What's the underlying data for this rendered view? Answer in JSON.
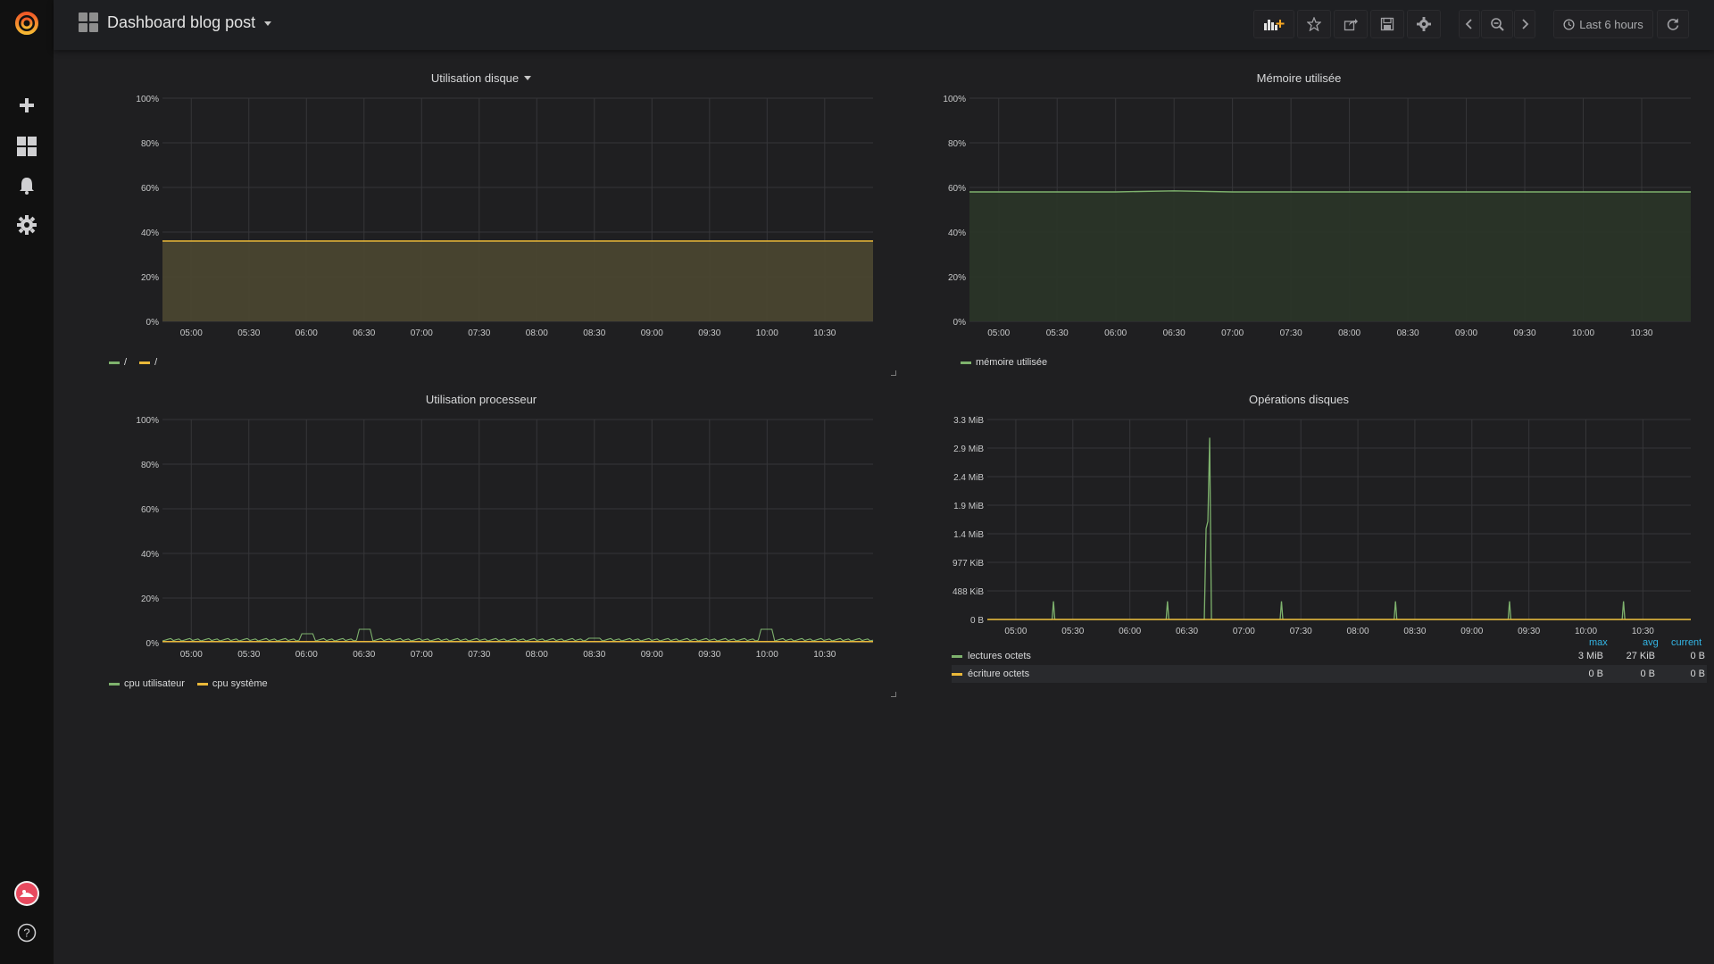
{
  "nav": {
    "title": "Dashboard blog post",
    "time_range": "Last 6 hours"
  },
  "sidemenu": {
    "icons": [
      "grafana-logo-icon",
      "plus-icon",
      "dashboards-icon",
      "bell-icon",
      "gear-icon",
      "avatar",
      "help-icon"
    ]
  },
  "colors": {
    "green": "#7eb26d",
    "yellow": "#eab839",
    "orange": "#ef843c",
    "blue_header": "#33b5e5",
    "panel_bg": "#1f1f21",
    "grid": "#363639"
  },
  "panels": {
    "disk": {
      "title": "Utilisation disque",
      "legend": [
        "/",
        "/"
      ]
    },
    "mem": {
      "title": "Mémoire utilisée",
      "legend": [
        "mémoire utilisée"
      ]
    },
    "cpu": {
      "title": "Utilisation processeur",
      "legend": [
        "cpu utilisateur",
        "cpu système"
      ]
    },
    "diskops": {
      "title": "Opérations disques",
      "legend_headers": [
        "max",
        "avg",
        "current"
      ],
      "legend_rows": [
        {
          "name": "lectures octets",
          "max": "3 MiB",
          "avg": "27 KiB",
          "current": "0 B"
        },
        {
          "name": "écriture octets",
          "max": "0 B",
          "avg": "0 B",
          "current": "0 B"
        }
      ]
    }
  },
  "chart_data": [
    {
      "type": "area",
      "title": "Utilisation disque",
      "x": [
        "05:00",
        "05:30",
        "06:00",
        "06:30",
        "07:00",
        "07:30",
        "08:00",
        "08:30",
        "09:00",
        "09:30",
        "10:00",
        "10:30"
      ],
      "y_ticks": [
        "0%",
        "20%",
        "40%",
        "60%",
        "80%",
        "100%"
      ],
      "ylim": [
        0,
        100
      ],
      "series": [
        {
          "name": "/",
          "color": "#7eb26d",
          "values": [
            36,
            36,
            36,
            36,
            36,
            36,
            36,
            36,
            36,
            36,
            36,
            36
          ]
        },
        {
          "name": "/",
          "color": "#eab839",
          "values": [
            36,
            36,
            36,
            36,
            36,
            36,
            36,
            36,
            36,
            36,
            36,
            36
          ]
        }
      ]
    },
    {
      "type": "area",
      "title": "Mémoire utilisée",
      "x": [
        "05:00",
        "05:30",
        "06:00",
        "06:30",
        "07:00",
        "07:30",
        "08:00",
        "08:30",
        "09:00",
        "09:30",
        "10:00",
        "10:30"
      ],
      "y_ticks": [
        "0%",
        "20%",
        "40%",
        "60%",
        "80%",
        "100%"
      ],
      "ylim": [
        0,
        100
      ],
      "series": [
        {
          "name": "mémoire utilisée",
          "color": "#7eb26d",
          "values": [
            58,
            58,
            58,
            58.5,
            58,
            58,
            58,
            58,
            58,
            58,
            58,
            58
          ]
        }
      ]
    },
    {
      "type": "line",
      "title": "Utilisation processeur",
      "x": [
        "05:00",
        "05:30",
        "06:00",
        "06:30",
        "07:00",
        "07:30",
        "08:00",
        "08:30",
        "09:00",
        "09:30",
        "10:00",
        "10:30"
      ],
      "y_ticks": [
        "0%",
        "20%",
        "40%",
        "60%",
        "80%",
        "100%"
      ],
      "ylim": [
        0,
        100
      ],
      "series": [
        {
          "name": "cpu utilisateur",
          "color": "#7eb26d",
          "values": [
            1,
            1,
            4,
            6,
            1,
            1,
            1,
            2,
            1,
            1,
            6,
            1
          ]
        },
        {
          "name": "cpu système",
          "color": "#eab839",
          "values": [
            0.5,
            0.5,
            0.5,
            0.5,
            0.5,
            0.5,
            0.5,
            0.5,
            0.5,
            0.5,
            0.5,
            0.5
          ]
        }
      ]
    },
    {
      "type": "line",
      "title": "Opérations disques",
      "x": [
        "05:00",
        "05:30",
        "06:00",
        "06:30",
        "07:00",
        "07:30",
        "08:00",
        "08:30",
        "09:00",
        "09:30",
        "10:00",
        "10:30"
      ],
      "y_ticks": [
        "0 B",
        "488 KiB",
        "977 KiB",
        "1.4 MiB",
        "1.9 MiB",
        "2.4 MiB",
        "2.9 MiB",
        "3.3 MiB"
      ],
      "ylim_mib": [
        0,
        3.3
      ],
      "series": [
        {
          "name": "lectures octets",
          "color": "#7eb26d",
          "spikes_mib": [
            [
              5.33,
              0.3
            ],
            [
              6.33,
              0.3
            ],
            [
              6.7,
              3.0
            ],
            [
              7.33,
              0.3
            ],
            [
              8.33,
              0.3
            ],
            [
              9.33,
              0.3
            ],
            [
              10.33,
              0.3
            ]
          ]
        },
        {
          "name": "écriture octets",
          "color": "#eab839",
          "values_mib": [
            0,
            0,
            0,
            0,
            0,
            0,
            0,
            0,
            0,
            0,
            0,
            0
          ]
        }
      ]
    }
  ]
}
